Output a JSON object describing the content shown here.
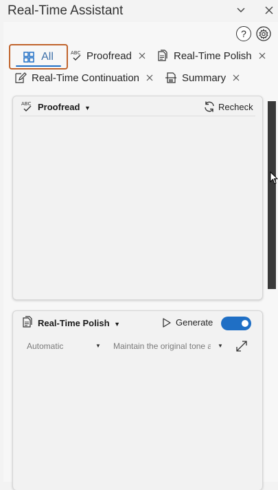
{
  "window": {
    "title": "Real-Time Assistant"
  },
  "toolbar": {
    "help": "?"
  },
  "tabs": [
    {
      "label": "All",
      "icon": "grid-icon"
    },
    {
      "label": "Proofread",
      "icon": "spellcheck-icon"
    },
    {
      "label": "Real-Time Polish",
      "icon": "document-icon"
    },
    {
      "label": "Real-Time Continuation",
      "icon": "edit-icon"
    },
    {
      "label": "Summary",
      "icon": "summary-icon"
    }
  ],
  "proofread_card": {
    "title": "Proofread",
    "recheck_label": "Recheck"
  },
  "polish_card": {
    "title": "Real-Time Polish",
    "generate_label": "Generate",
    "generate_on": true,
    "mode_value": "Automatic",
    "tone_value": "Maintain the original tone a"
  },
  "colors": {
    "accent": "#1f6fc5",
    "selected_border": "#c0622a"
  }
}
